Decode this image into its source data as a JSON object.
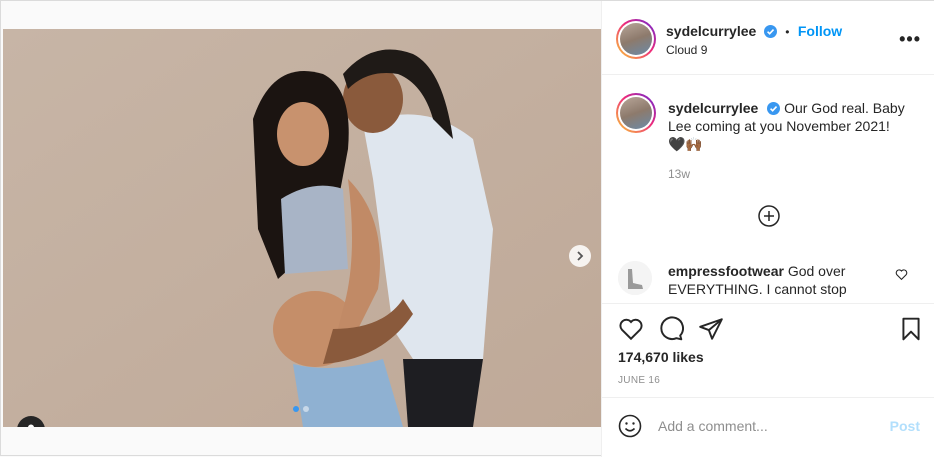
{
  "post": {
    "username": "sydelcurrylee",
    "location": "Cloud 9",
    "follow_label": "Follow",
    "separator": "•",
    "more_label": "•••",
    "caption_text": "Our God real. Baby Lee coming at you November 2021! 🖤🙌🏾",
    "caption_age": "13w",
    "likes": "174,670 likes",
    "date": "JUNE 16",
    "carousel_total": 2,
    "carousel_active": 1
  },
  "comments": [
    {
      "username": "empressfootwear",
      "text": "God over EVERYTHING. I cannot stop"
    }
  ],
  "add_comment": {
    "placeholder": "Add a comment...",
    "post_label": "Post"
  },
  "colors": {
    "accent": "#0095f6",
    "verified": "#3897f0",
    "post_disabled": "#b2dffc"
  },
  "icons": [
    "verified-badge-icon",
    "more-options-icon",
    "add-circle-icon",
    "heart-icon",
    "comment-icon",
    "share-icon",
    "bookmark-icon",
    "emoji-icon",
    "chevron-right-icon",
    "user-tag-icon"
  ]
}
